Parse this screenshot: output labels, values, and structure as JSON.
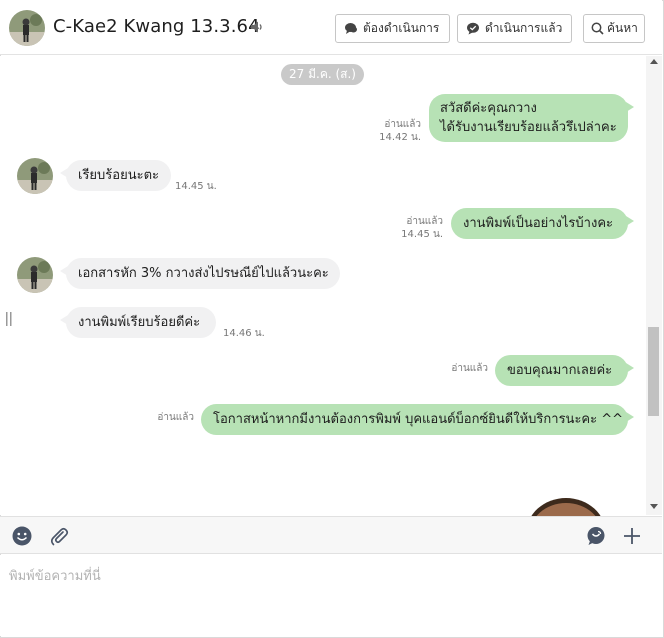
{
  "header": {
    "title": "C-Kae2 Kwang 13.3.64",
    "buttons": {
      "todo": "ต้องดำเนินการ",
      "done": "ดำเนินการแล้ว",
      "search": "ค้นหา"
    }
  },
  "chat": {
    "date": "27 มี.ค. (ส.)",
    "messages": [
      {
        "dir": "out",
        "lines": [
          "สวัสดีค่ะคุณกวาง",
          "ได้รับงานเรียบร้อยแล้วรึเปล่าคะ"
        ],
        "read": "อ่านแล้ว",
        "time": "14.42 น."
      },
      {
        "dir": "in",
        "text": "เรียบร้อยนะตะ",
        "time": "14.45 น."
      },
      {
        "dir": "out",
        "text": "งานพิมพ์เป็นอย่างไรบ้างคะ",
        "read": "อ่านแล้ว",
        "time": "14.45 น."
      },
      {
        "dir": "in",
        "text": "เอกสารหัก 3% กวางส่งไปรษณีย์ไปแล้วนะคะ"
      },
      {
        "dir": "in",
        "text": "งานพิมพ์เรียบร้อยดีค่ะ",
        "time": "14.46 น."
      },
      {
        "dir": "out",
        "text": "ขอบคุณมากเลยค่ะ",
        "read": "อ่านแล้ว"
      },
      {
        "dir": "out",
        "text": "โอกาสหน้าหากมีงานต้องการพิมพ์ บุคแอนด์บ็อกซ์ยินดีให้บริการนะคะ ^^",
        "read": "อ่านแล้ว"
      }
    ]
  },
  "input": {
    "placeholder": "พิมพ์ข้อความที่นี่"
  },
  "icons": {
    "speaker": "speaker-icon",
    "todo": "chat-bubble-icon",
    "done": "chat-check-icon",
    "search": "search-icon",
    "emoji": "emoji-icon",
    "attach": "paperclip-icon",
    "sticker": "sticker-chat-icon",
    "add": "plus-icon"
  },
  "colors": {
    "outgoing_bubble": "#b7e2b5",
    "incoming_bubble": "#f1f1f2",
    "date_pill": "#c9c9c9"
  }
}
